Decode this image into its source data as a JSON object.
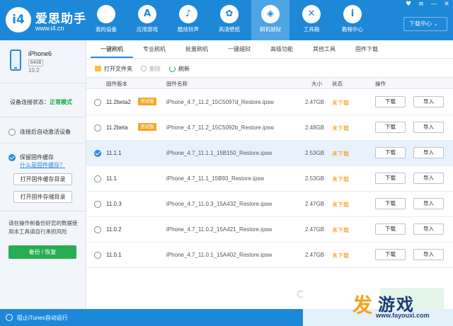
{
  "app": {
    "logo_text": "i4",
    "name": "爱思助手",
    "url": "www.i4.cn"
  },
  "nav": [
    {
      "label": "我的设备",
      "icon": "apple-icon",
      "glyph": ""
    },
    {
      "label": "应用游戏",
      "icon": "appstore-icon",
      "glyph": "A"
    },
    {
      "label": "酷炫铃声",
      "icon": "bell-icon",
      "glyph": "♪"
    },
    {
      "label": "高清壁纸",
      "icon": "flower-icon",
      "glyph": "✿"
    },
    {
      "label": "刷机越狱",
      "icon": "dropbox-icon",
      "glyph": "◈"
    },
    {
      "label": "工具箱",
      "icon": "tools-icon",
      "glyph": "✕"
    },
    {
      "label": "教程中心",
      "icon": "info-icon",
      "glyph": "i"
    }
  ],
  "window_controls": {
    "menu": "♥",
    "list": "≡",
    "minimize": "—",
    "close": "✕"
  },
  "download_center": "下载中心 ⌄",
  "device": {
    "name": "iPhone6",
    "capacity": "64GB",
    "version": "10.2"
  },
  "sidebar": {
    "conn_label": "设备连接状态：",
    "conn_value": "正常模式",
    "auto_activate": "连接后自动激活设备",
    "keep_cache": "保留固件缓存",
    "what_cache": "什么是固件缓存？",
    "open_cache_dir": "打开固件缓存目录",
    "open_store_dir": "打开固件存储目录",
    "warning": "请在操作前备份好您的数据使用本工具请自行承担风险",
    "backup_btn": "备份 / 恢复"
  },
  "tabs": [
    "一键刷机",
    "专业刷机",
    "批量刷机",
    "一键越狱",
    "高级功能",
    "其他工具",
    "固件下载"
  ],
  "toolbar": {
    "open_folder": "打开文件夹",
    "delete": "删除",
    "refresh": "刷新"
  },
  "table": {
    "headers": {
      "version": "固件版本",
      "name": "固件名称",
      "size": "大小",
      "status": "状态",
      "action": "操作"
    },
    "rows": [
      {
        "version": "11.2beta2",
        "beta": "测试版",
        "name": "iPhone_4.7_11.2_15C5097d_Restore.ipsw",
        "size": "2.47GB",
        "status": "未下载",
        "download": "下载",
        "import": "导入",
        "selected": false
      },
      {
        "version": "11.2beta",
        "beta": "测试版",
        "name": "iPhone_4.7_11.2_15C5092b_Restore.ipsw",
        "size": "2.48GB",
        "status": "未下载",
        "download": "下载",
        "import": "导入",
        "selected": false
      },
      {
        "version": "11.1.1",
        "beta": "",
        "name": "iPhone_4.7_11.1.1_15B150_Restore.ipsw",
        "size": "2.53GB",
        "status": "未下载",
        "download": "下载",
        "import": "导入",
        "selected": true
      },
      {
        "version": "11.1",
        "beta": "",
        "name": "iPhone_4.7_11.1_15B93_Restore.ipsw",
        "size": "2.53GB",
        "status": "未下载",
        "download": "下载",
        "import": "导入",
        "selected": false
      },
      {
        "version": "11.0.3",
        "beta": "",
        "name": "iPhone_4.7_11.0.3_15A432_Restore.ipsw",
        "size": "2.47GB",
        "status": "未下载",
        "download": "下载",
        "import": "导入",
        "selected": false
      },
      {
        "version": "11.0.2",
        "beta": "",
        "name": "iPhone_4.7_11.0.2_15A421_Restore.ipsw",
        "size": "2.47GB",
        "status": "未下载",
        "download": "下载",
        "import": "导入",
        "selected": false
      },
      {
        "version": "11.0.1",
        "beta": "",
        "name": "iPhone_4.7_11.0.1_15A402_Restore.ipsw",
        "size": "2.47GB",
        "status": "未下载",
        "download": "下载",
        "import": "导入",
        "selected": false
      }
    ]
  },
  "statusbar": {
    "text": "阻止iTunes自动运行"
  },
  "watermark": {
    "mark": "发",
    "text": "游戏",
    "url": "www.fayouxi.com"
  },
  "colors": {
    "brand_blue": "#1e88d8",
    "accent_green": "#27ae54",
    "warn_orange": "#f08c00",
    "beta_orange": "#f5a623"
  }
}
